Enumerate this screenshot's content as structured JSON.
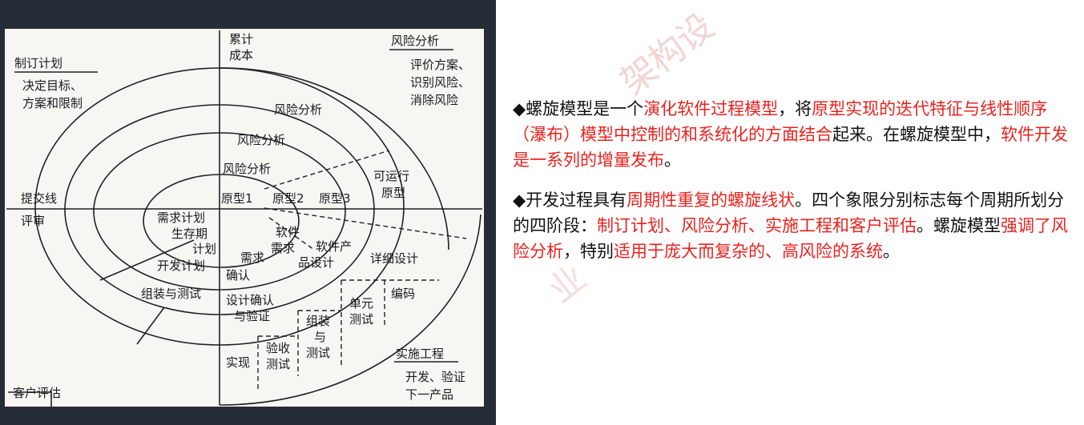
{
  "diagram": {
    "axis_top": [
      "累计",
      "成本"
    ],
    "quadrants": {
      "top_left": {
        "title": "制订计划",
        "items": [
          "决定目标、",
          "方案和限制"
        ]
      },
      "top_right": {
        "title": "风险分析",
        "items": [
          "评价方案、",
          "识别风险、",
          "消除风险"
        ]
      },
      "left": {
        "title": "提交线",
        "subtitle": "评审"
      },
      "bottom_left": {
        "title": "客户评估"
      },
      "bottom_right": {
        "title": "实施工程",
        "items": [
          "开发、验证",
          "下一产品"
        ]
      }
    },
    "risk_labels": [
      "风险分析",
      "风险分析",
      "风险分析"
    ],
    "prototypes": [
      "原型1",
      "原型2",
      "原型3"
    ],
    "operational_prototype": [
      "可运行",
      "原型"
    ],
    "plan_labels": {
      "requirements_plan": [
        "需求计划",
        "生存期",
        "计划"
      ],
      "dev_plan": "开发计划",
      "integration_test": "组装与测试"
    },
    "engineering": {
      "software_requirements": [
        "软件",
        "需求"
      ],
      "requirements_confirm": [
        "需求",
        "确认"
      ],
      "software_product_design": [
        "软件产",
        "品设计"
      ],
      "detailed_design": "详细设计",
      "design_verify": [
        "设计确认",
        "与验证"
      ],
      "unit_test": [
        "单元",
        "测试"
      ],
      "coding": "编码",
      "assembly_test": [
        "组装",
        "与",
        "测试"
      ],
      "acceptance_test": [
        "验收",
        "测试"
      ],
      "implementation": "实现"
    }
  },
  "description": {
    "p1": [
      {
        "t": "◆螺旋模型是一个",
        "h": false
      },
      {
        "t": "演化软件过程模型",
        "h": true
      },
      {
        "t": "，将",
        "h": false
      },
      {
        "t": "原型实现的迭代特征与线性顺序（瀑布）模型中控制的和系统化的方面结合",
        "h": true
      },
      {
        "t": "起来。在螺旋模型中，",
        "h": false
      },
      {
        "t": "软件开发是一系列的增量发布",
        "h": true
      },
      {
        "t": "。",
        "h": false
      }
    ],
    "p2": [
      {
        "t": "◆开发过程具有",
        "h": false
      },
      {
        "t": "周期性重复的螺旋线状",
        "h": true
      },
      {
        "t": "。四个象限分别标志每个周期所划分的四阶段：",
        "h": false
      },
      {
        "t": "制订计划、风险分析、实施工程和客户评估",
        "h": true
      },
      {
        "t": "。螺旋模型",
        "h": false
      },
      {
        "t": "强调了风险分析",
        "h": true
      },
      {
        "t": "，特别",
        "h": false
      },
      {
        "t": "适用于庞大而复杂的、高风险的系统",
        "h": true
      },
      {
        "t": "。",
        "h": false
      }
    ]
  },
  "watermark": [
    "架构设",
    "业"
  ],
  "colors": {
    "background": "#ffffff",
    "left_panel": "#262d37",
    "text": "#111111",
    "highlight": "#e8221d",
    "watermark": "#e3a0a0"
  }
}
